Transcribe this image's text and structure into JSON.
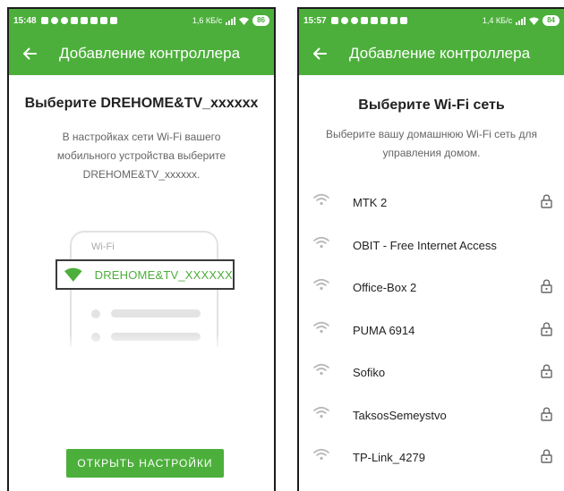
{
  "left": {
    "status": {
      "time": "15:48",
      "speed": "1,6 КБ/с",
      "battery": "86"
    },
    "appbar": {
      "title": "Добавление контроллера"
    },
    "heading": "Выберите DREHOME&TV_xxxxxx",
    "description": "В настройках сети Wi-Fi вашего мобильного устройства выберите DREHOME&TV_xxxxxx.",
    "illustration": {
      "label": "Wi-Fi",
      "network": "DREHOME&TV_XXXXXX"
    },
    "button": "ОТКРЫТЬ НАСТРОЙКИ"
  },
  "right": {
    "status": {
      "time": "15:57",
      "speed": "1,4 КБ/с",
      "battery": "84"
    },
    "appbar": {
      "title": "Добавление контроллера"
    },
    "heading": "Выберите Wi-Fi сеть",
    "description": "Выберите вашу домашнюю Wi-Fi сеть для управления домом.",
    "networks": [
      {
        "ssid": "MTK 2",
        "secured": true
      },
      {
        "ssid": "OBIT - Free Internet Access",
        "secured": false
      },
      {
        "ssid": "Office-Box 2",
        "secured": true
      },
      {
        "ssid": "PUMA 6914",
        "secured": true
      },
      {
        "ssid": "Sofiko",
        "secured": true
      },
      {
        "ssid": "TaksosSemeystvo",
        "secured": true
      },
      {
        "ssid": "TP-Link_4279",
        "secured": true
      }
    ]
  },
  "colors": {
    "accent": "#4caf3b",
    "text": "#222222",
    "muted": "#666666"
  }
}
